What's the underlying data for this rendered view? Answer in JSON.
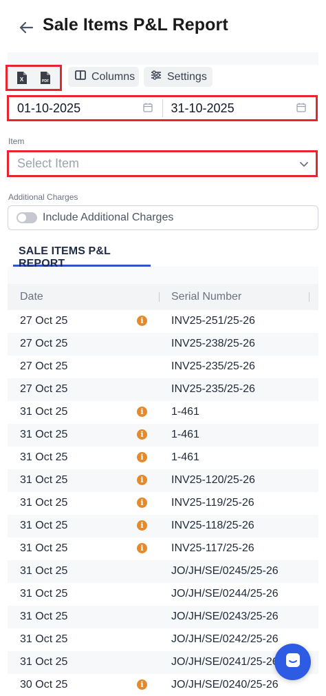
{
  "header": {
    "title": "Sale Items P&L Report"
  },
  "toolbar": {
    "excel_icon_letter": "X",
    "pdf_icon_text": "PDF",
    "columns_label": "Columns",
    "settings_label": "Settings"
  },
  "filters": {
    "start_date": "01-10-2025",
    "end_date": "31-10-2025",
    "item_label": "Item",
    "item_placeholder": "Select Item",
    "charges_label": "Additional Charges",
    "charges_toggle_label": "Include Additional Charges",
    "charges_toggle_on": false
  },
  "report": {
    "tab_label": "SALE ITEMS P&L REPORT",
    "columns": [
      "Date",
      "Serial Number"
    ],
    "rows": [
      {
        "date": "27 Oct 25",
        "serial": "INV25-251/25-26",
        "info": true
      },
      {
        "date": "27 Oct 25",
        "serial": "INV25-238/25-26",
        "info": false
      },
      {
        "date": "27 Oct 25",
        "serial": "INV25-235/25-26",
        "info": false
      },
      {
        "date": "27 Oct 25",
        "serial": "INV25-235/25-26",
        "info": false
      },
      {
        "date": "31 Oct 25",
        "serial": "1-461",
        "info": true
      },
      {
        "date": "31 Oct 25",
        "serial": "1-461",
        "info": true
      },
      {
        "date": "31 Oct 25",
        "serial": "1-461",
        "info": true
      },
      {
        "date": "31 Oct 25",
        "serial": "INV25-120/25-26",
        "info": true
      },
      {
        "date": "31 Oct 25",
        "serial": "INV25-119/25-26",
        "info": true
      },
      {
        "date": "31 Oct 25",
        "serial": "INV25-118/25-26",
        "info": true
      },
      {
        "date": "31 Oct 25",
        "serial": "INV25-117/25-26",
        "info": true
      },
      {
        "date": "31 Oct 25",
        "serial": "JO/JH/SE/0245/25-26",
        "info": false
      },
      {
        "date": "31 Oct 25",
        "serial": "JO/JH/SE/0244/25-26",
        "info": false
      },
      {
        "date": "31 Oct 25",
        "serial": "JO/JH/SE/0243/25-26",
        "info": false
      },
      {
        "date": "31 Oct 25",
        "serial": "JO/JH/SE/0242/25-26",
        "info": false
      },
      {
        "date": "31 Oct 25",
        "serial": "JO/JH/SE/0241/25-26",
        "info": false
      },
      {
        "date": "30 Oct 25",
        "serial": "JO/JH/SE/0240/25-26",
        "info": true
      }
    ],
    "info_glyph": "i"
  },
  "colors": {
    "highlight": "#e8242f",
    "accent": "#2f53c9",
    "info": "#e58a2c",
    "fab": "#2e5be4"
  },
  "icons": [
    "back-arrow-icon",
    "excel-icon",
    "pdf-icon",
    "columns-icon",
    "settings-sliders-icon",
    "calendar-icon",
    "chevron-down-icon",
    "info-icon",
    "chat-icon"
  ]
}
